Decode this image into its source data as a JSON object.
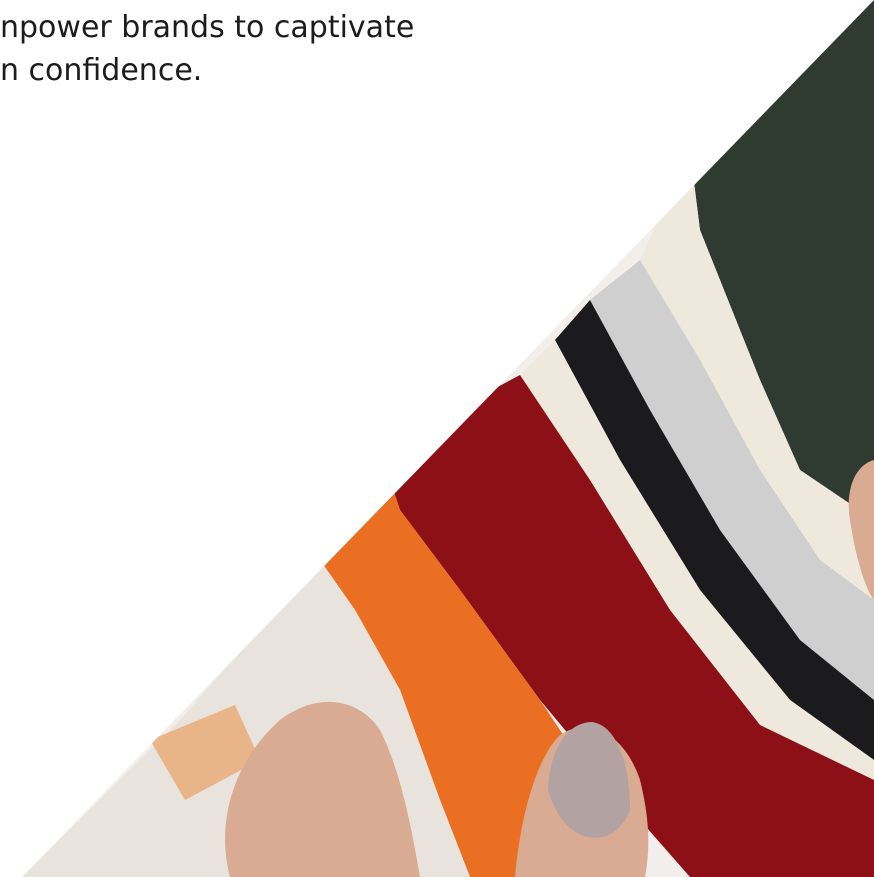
{
  "hero": {
    "headline_line1": "npower brands to captivate",
    "headline_line2": "n confidence."
  },
  "photo": {
    "icon": "fabric-swatches-photo",
    "colors": {
      "dark_green": "#2f3a30",
      "cream": "#efe8dc",
      "light_grey": "#cfcfcf",
      "black": "#1b1b1d",
      "red": "#8e1017",
      "orange": "#ea6f22",
      "skin": "#d9ab93",
      "nail": "#b3a2a2"
    }
  }
}
